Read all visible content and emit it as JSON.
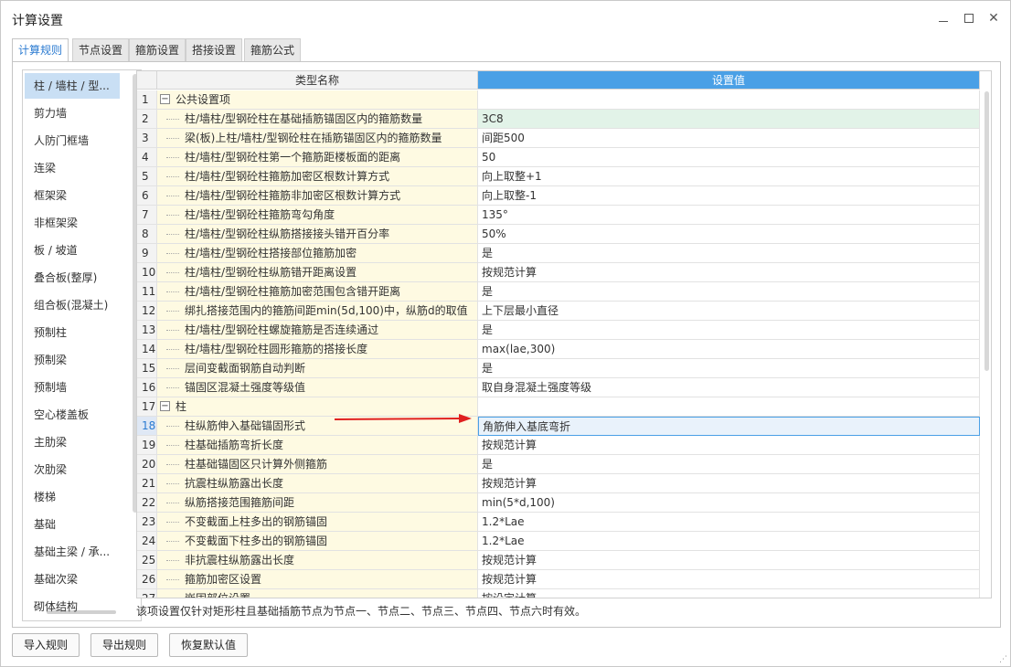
{
  "window": {
    "title": "计算设置"
  },
  "tabs": [
    {
      "label": "计算规则",
      "active": true
    },
    {
      "label": "节点设置",
      "active": false
    },
    {
      "label": "箍筋设置",
      "active": false
    },
    {
      "label": "搭接设置",
      "active": false
    },
    {
      "label": "箍筋公式",
      "active": false
    }
  ],
  "sidebar": {
    "items": [
      {
        "label": "柱 / 墙柱 / 型...",
        "selected": true
      },
      {
        "label": "剪力墙"
      },
      {
        "label": "人防门框墙"
      },
      {
        "label": "连梁"
      },
      {
        "label": "框架梁"
      },
      {
        "label": "非框架梁"
      },
      {
        "label": "板 / 坡道"
      },
      {
        "label": "叠合板(整厚)"
      },
      {
        "label": "组合板(混凝土)"
      },
      {
        "label": "预制柱"
      },
      {
        "label": "预制梁"
      },
      {
        "label": "预制墙"
      },
      {
        "label": "空心楼盖板"
      },
      {
        "label": "主肋梁"
      },
      {
        "label": "次肋梁"
      },
      {
        "label": "楼梯"
      },
      {
        "label": "基础"
      },
      {
        "label": "基础主梁 / 承..."
      },
      {
        "label": "基础次梁"
      },
      {
        "label": "砌体结构"
      }
    ]
  },
  "grid": {
    "header": {
      "name": "类型名称",
      "value": "设置值"
    },
    "rows": [
      {
        "num": "1",
        "name": "公共设置项",
        "value": "",
        "group": true
      },
      {
        "num": "2",
        "name": "柱/墙柱/型钢砼柱在基础插筋锚固区内的箍筋数量",
        "value": "3C8",
        "highlight": "green"
      },
      {
        "num": "3",
        "name": "梁(板)上柱/墙柱/型钢砼柱在插筋锚固区内的箍筋数量",
        "value": "间距500"
      },
      {
        "num": "4",
        "name": "柱/墙柱/型钢砼柱第一个箍筋距楼板面的距离",
        "value": "50"
      },
      {
        "num": "5",
        "name": "柱/墙柱/型钢砼柱箍筋加密区根数计算方式",
        "value": "向上取整+1"
      },
      {
        "num": "6",
        "name": "柱/墙柱/型钢砼柱箍筋非加密区根数计算方式",
        "value": "向上取整-1"
      },
      {
        "num": "7",
        "name": "柱/墙柱/型钢砼柱箍筋弯勾角度",
        "value": "135°"
      },
      {
        "num": "8",
        "name": "柱/墙柱/型钢砼柱纵筋搭接接头错开百分率",
        "value": "50%"
      },
      {
        "num": "9",
        "name": "柱/墙柱/型钢砼柱搭接部位箍筋加密",
        "value": "是"
      },
      {
        "num": "10",
        "name": "柱/墙柱/型钢砼柱纵筋错开距离设置",
        "value": "按规范计算"
      },
      {
        "num": "11",
        "name": "柱/墙柱/型钢砼柱箍筋加密范围包含错开距离",
        "value": "是"
      },
      {
        "num": "12",
        "name": "绑扎搭接范围内的箍筋间距min(5d,100)中，纵筋d的取值",
        "value": "上下层最小直径"
      },
      {
        "num": "13",
        "name": "柱/墙柱/型钢砼柱螺旋箍筋是否连续通过",
        "value": "是"
      },
      {
        "num": "14",
        "name": "柱/墙柱/型钢砼柱圆形箍筋的搭接长度",
        "value": "max(lae,300)"
      },
      {
        "num": "15",
        "name": "层间变截面钢筋自动判断",
        "value": "是"
      },
      {
        "num": "16",
        "name": "锚固区混凝土强度等级值",
        "value": "取自身混凝土强度等级"
      },
      {
        "num": "17",
        "name": "柱",
        "value": "",
        "group": true
      },
      {
        "num": "18",
        "name": "柱纵筋伸入基础锚固形式",
        "value": "角筋伸入基底弯折",
        "highlight": "focus"
      },
      {
        "num": "19",
        "name": "柱基础插筋弯折长度",
        "value": "按规范计算"
      },
      {
        "num": "20",
        "name": "柱基础锚固区只计算外侧箍筋",
        "value": "是"
      },
      {
        "num": "21",
        "name": "抗震柱纵筋露出长度",
        "value": "按规范计算"
      },
      {
        "num": "22",
        "name": "纵筋搭接范围箍筋间距",
        "value": "min(5*d,100)"
      },
      {
        "num": "23",
        "name": "不变截面上柱多出的钢筋锚固",
        "value": "1.2*Lae"
      },
      {
        "num": "24",
        "name": "不变截面下柱多出的钢筋锚固",
        "value": "1.2*Lae"
      },
      {
        "num": "25",
        "name": "非抗震柱纵筋露出长度",
        "value": "按规范计算"
      },
      {
        "num": "26",
        "name": "箍筋加密区设置",
        "value": "按规范计算"
      },
      {
        "num": "27",
        "name": "嵌固部位设置",
        "value": "按设定计算"
      }
    ]
  },
  "hint": "该项设置仅针对矩形柱且基础插筋节点为节点一、节点二、节点三、节点四、节点六时有效。",
  "buttons": {
    "import": "导入规则",
    "export": "导出规则",
    "reset": "恢复默认值"
  },
  "colors": {
    "accent": "#4aa0e6",
    "selected_nav": "#c9dff4",
    "name_cell_bg": "#fefae2",
    "green_row": "#e2f3e8",
    "annotation_arrow": "#e02020"
  }
}
